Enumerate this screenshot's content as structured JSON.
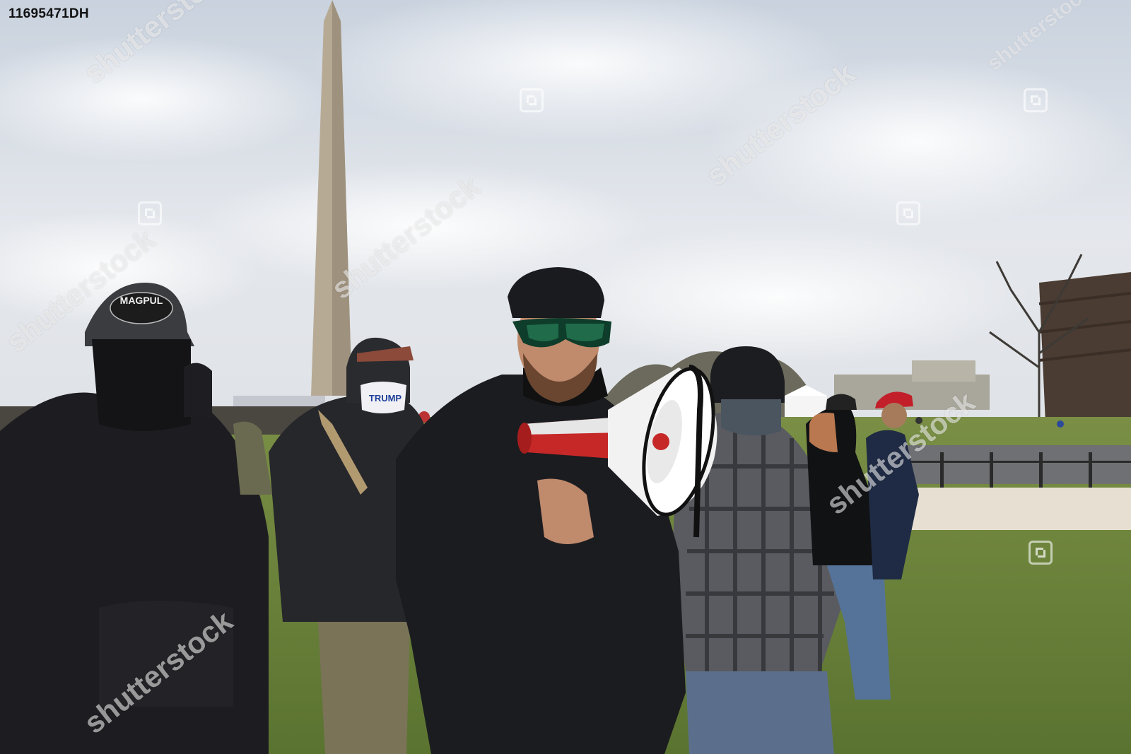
{
  "photo": {
    "image_id": "11695471DH",
    "watermark_text": "shutterstock",
    "cap_logo_text": "MAGPUL",
    "mask_text": "TRUMP"
  },
  "colors": {
    "sky": "#d9dee6",
    "grass": "#6f8a3c",
    "jacket": "#1b1c20",
    "megaphone_red": "#c62828",
    "sunglasses": "#1f6b4a"
  }
}
